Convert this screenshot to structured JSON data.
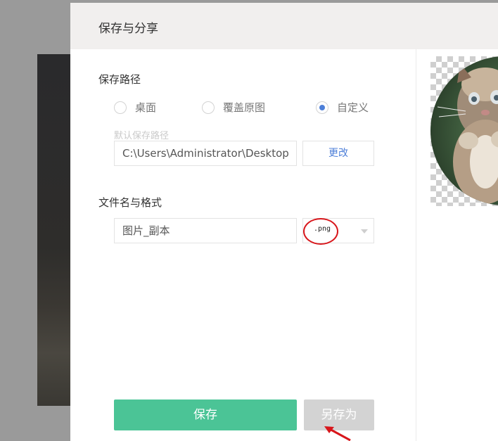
{
  "dialog": {
    "title": "保存与分享"
  },
  "save_path": {
    "label": "保存路径",
    "options": [
      {
        "label": "桌面",
        "selected": false
      },
      {
        "label": "覆盖原图",
        "selected": false
      },
      {
        "label": "自定义",
        "selected": true
      }
    ],
    "hint": "默认保存路径",
    "path_value": "C:\\Users\\Administrator\\Desktop",
    "change_button": "更改"
  },
  "filename": {
    "label": "文件名与格式",
    "name_value": "图片_副本",
    "format_selected": ".png"
  },
  "actions": {
    "save": "保存",
    "save_as": "另存为"
  },
  "colors": {
    "primary": "#4bc496",
    "accent": "#4d7fd8",
    "annotation": "#d8161b",
    "disabled": "#d3d3d3"
  },
  "preview": {
    "icon": "cat-photo-preview"
  }
}
